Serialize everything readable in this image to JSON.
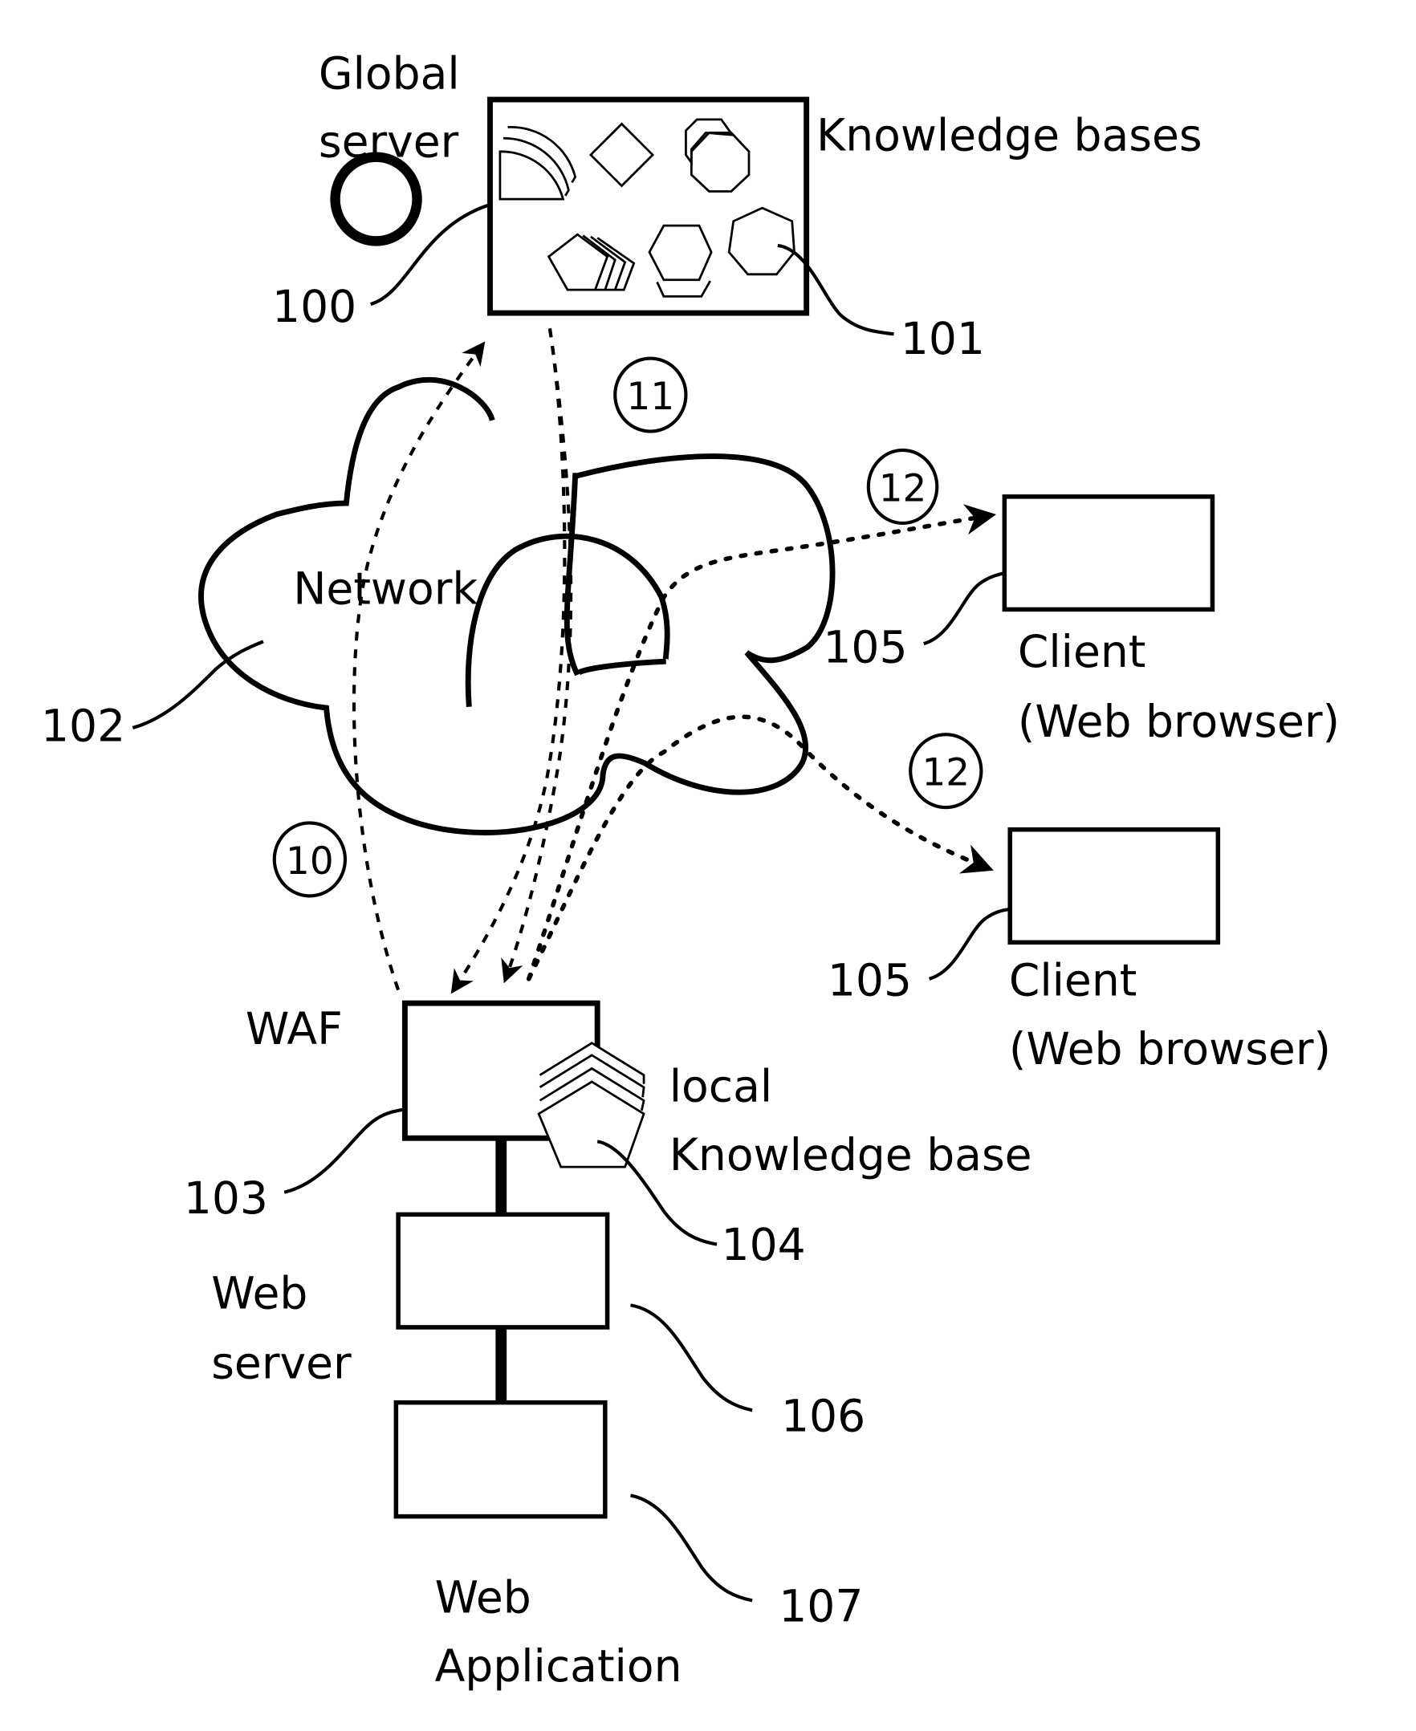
{
  "diagram": {
    "global_server": {
      "label_line1": "Global",
      "label_line2": "server",
      "ref": "100"
    },
    "knowledge_bases": {
      "label": "Knowledge bases",
      "ref": "101"
    },
    "network": {
      "label": "Network",
      "ref": "102"
    },
    "waf": {
      "label": "WAF",
      "ref": "103"
    },
    "local_kb": {
      "label_line1": "local",
      "label_line2": "Knowledge base",
      "ref": "104"
    },
    "clients": [
      {
        "label_line1": "Client",
        "label_line2": "(Web browser)",
        "ref": "105"
      },
      {
        "label_line1": "Client",
        "label_line2": "(Web browser)",
        "ref": "105"
      }
    ],
    "web_server": {
      "label_line1": "Web",
      "label_line2": "server",
      "ref": "106"
    },
    "web_application": {
      "label_line1": "Web",
      "label_line2": "Application",
      "ref": "107"
    },
    "steps": [
      {
        "label": "10",
        "meaning": "WAF to knowledge bases"
      },
      {
        "label": "11",
        "meaning": "knowledge bases to WAF"
      },
      {
        "label": "12",
        "meaning": "WAF to client 1"
      },
      {
        "label": "12",
        "meaning": "WAF to client 2"
      }
    ]
  }
}
